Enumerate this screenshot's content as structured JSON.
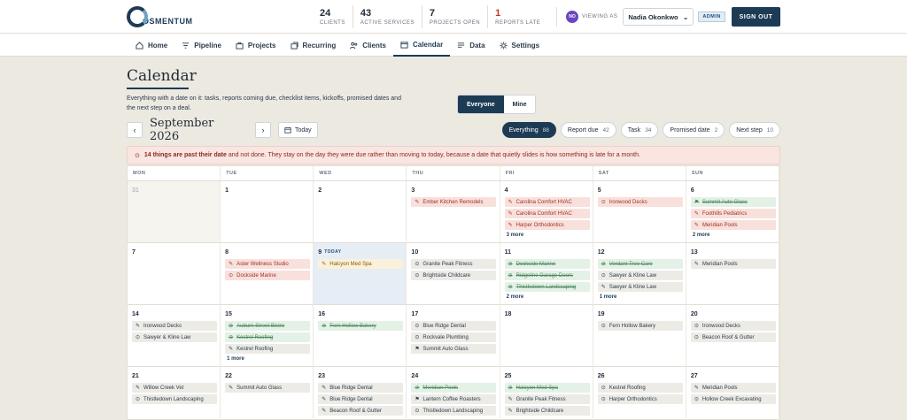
{
  "brand": {
    "name": "OSMENTUM"
  },
  "stats": [
    {
      "num": "24",
      "label": "CLIENTS",
      "alert": false
    },
    {
      "num": "43",
      "label": "ACTIVE SERVICES",
      "alert": false
    },
    {
      "num": "7",
      "label": "PROJECTS OPEN",
      "alert": false
    },
    {
      "num": "1",
      "label": "REPORTS LATE",
      "alert": true
    }
  ],
  "user": {
    "initials": "NO",
    "viewing_label": "VIEWING AS",
    "name": "Nadia Okonkwo",
    "role": "ADMIN"
  },
  "signout_label": "SIGN OUT",
  "nav": [
    {
      "label": "Home",
      "icon": "home-icon"
    },
    {
      "label": "Pipeline",
      "icon": "funnel-icon"
    },
    {
      "label": "Projects",
      "icon": "briefcase-icon"
    },
    {
      "label": "Recurring",
      "icon": "stack-icon"
    },
    {
      "label": "Clients",
      "icon": "people-icon"
    },
    {
      "label": "Calendar",
      "icon": "calendar-icon",
      "active": true
    },
    {
      "label": "Data",
      "icon": "lines-icon"
    },
    {
      "label": "Settings",
      "icon": "gear-icon"
    }
  ],
  "page": {
    "title": "Calendar",
    "description": "Everything with a date on it: tasks, reports coming due, checklist items, kickoffs, promised dates and the next step on a deal."
  },
  "scope_toggle": [
    {
      "label": "Everyone",
      "active": true
    },
    {
      "label": "Mine",
      "active": false
    }
  ],
  "month": {
    "label": "September 2026",
    "today_label": "Today"
  },
  "filters": [
    {
      "label": "Everything",
      "count": "88",
      "active": true
    },
    {
      "label": "Report due",
      "count": "42",
      "active": false
    },
    {
      "label": "Task",
      "count": "34",
      "active": false
    },
    {
      "label": "Promised date",
      "count": "2",
      "active": false
    },
    {
      "label": "Next step",
      "count": "10",
      "active": false
    }
  ],
  "warning": {
    "bold": "14 things are past their date",
    "rest": "and not done. They stay on the day they were due rather than moving to today, because a date that quietly slides is how something is late for a month."
  },
  "weekdays": [
    "MON",
    "TUE",
    "WED",
    "THU",
    "FRI",
    "SAT",
    "SUN"
  ],
  "colors": {
    "primary": "#1d3b55",
    "late": "#a33020",
    "done": "#4f8a5e",
    "today": "#e6edf5"
  },
  "weeks": [
    [
      {
        "day": "31",
        "muted": true,
        "events": []
      },
      {
        "day": "1",
        "events": []
      },
      {
        "day": "2",
        "events": []
      },
      {
        "day": "3",
        "events": [
          {
            "t": "Ember Kitchen Remodels",
            "k": "red",
            "i": "task"
          }
        ]
      },
      {
        "day": "4",
        "events": [
          {
            "t": "Carolina Comfort HVAC",
            "k": "red",
            "i": "task"
          },
          {
            "t": "Carolina Comfort HVAC",
            "k": "red",
            "i": "task"
          },
          {
            "t": "Harper Orthodontics",
            "k": "red",
            "i": "task"
          }
        ],
        "more": "3 more"
      },
      {
        "day": "5",
        "events": [
          {
            "t": "Ironwood Decks",
            "k": "red",
            "i": "report"
          }
        ]
      },
      {
        "day": "6",
        "events": [
          {
            "t": "Summit Auto Glass",
            "k": "done",
            "i": "flag"
          },
          {
            "t": "Foothills Pediatrics",
            "k": "red",
            "i": "task"
          },
          {
            "t": "Meridian Pools",
            "k": "red",
            "i": "task"
          }
        ],
        "more": "2 more"
      }
    ],
    [
      {
        "day": "7",
        "events": []
      },
      {
        "day": "8",
        "events": [
          {
            "t": "Aster Wellness Studio",
            "k": "red",
            "i": "task"
          },
          {
            "t": "Dockside Marine",
            "k": "red",
            "i": "report"
          }
        ]
      },
      {
        "day": "9",
        "today": true,
        "today_label": "TODAY",
        "events": [
          {
            "t": "Halcyon Med Spa",
            "k": "yellow",
            "i": "task"
          }
        ]
      },
      {
        "day": "10",
        "events": [
          {
            "t": "Granite Peak Fitness",
            "k": "grey",
            "i": "report"
          },
          {
            "t": "Brightside Childcare",
            "k": "grey",
            "i": "report"
          }
        ]
      },
      {
        "day": "11",
        "events": [
          {
            "t": "Dockside Marine",
            "k": "done",
            "i": "check"
          },
          {
            "t": "Ridgeline Garage Doors",
            "k": "done",
            "i": "check"
          },
          {
            "t": "Thistledown Landscaping",
            "k": "done",
            "i": "check"
          }
        ],
        "more": "2 more"
      },
      {
        "day": "12",
        "events": [
          {
            "t": "Verdant Tree Care",
            "k": "done",
            "i": "check"
          },
          {
            "t": "Sawyer & Kline Law",
            "k": "grey",
            "i": "report"
          },
          {
            "t": "Sawyer & Kline Law",
            "k": "grey",
            "i": "task"
          }
        ],
        "more": "1 more"
      },
      {
        "day": "13",
        "events": [
          {
            "t": "Meridian Pools",
            "k": "grey",
            "i": "task"
          }
        ]
      }
    ],
    [
      {
        "day": "14",
        "events": [
          {
            "t": "Ironwood Decks",
            "k": "grey",
            "i": "task"
          },
          {
            "t": "Sawyer & Kline Law",
            "k": "grey",
            "i": "report"
          }
        ]
      },
      {
        "day": "15",
        "events": [
          {
            "t": "Auburn Street Bistro",
            "k": "done",
            "i": "check"
          },
          {
            "t": "Kestrel Roofing",
            "k": "done",
            "i": "check"
          },
          {
            "t": "Kestrel Roofing",
            "k": "grey",
            "i": "task"
          }
        ],
        "more": "1 more"
      },
      {
        "day": "16",
        "events": [
          {
            "t": "Fern Hollow Bakery",
            "k": "done",
            "i": "check"
          }
        ]
      },
      {
        "day": "17",
        "events": [
          {
            "t": "Blue Ridge Dental",
            "k": "grey",
            "i": "report"
          },
          {
            "t": "Rockvale Plumbing",
            "k": "grey",
            "i": "report"
          },
          {
            "t": "Summit Auto Glass",
            "k": "grey",
            "i": "flag"
          }
        ]
      },
      {
        "day": "18",
        "events": []
      },
      {
        "day": "19",
        "events": [
          {
            "t": "Fern Hollow Bakery",
            "k": "grey",
            "i": "report"
          }
        ]
      },
      {
        "day": "20",
        "events": [
          {
            "t": "Ironwood Decks",
            "k": "grey",
            "i": "report"
          },
          {
            "t": "Beacon Roof & Gutter",
            "k": "grey",
            "i": "report"
          }
        ]
      }
    ],
    [
      {
        "day": "21",
        "events": [
          {
            "t": "Willow Creek Vet",
            "k": "grey",
            "i": "task"
          },
          {
            "t": "Thistledown Landscaping",
            "k": "grey",
            "i": "report"
          }
        ]
      },
      {
        "day": "22",
        "events": [
          {
            "t": "Summit Auto Glass",
            "k": "grey",
            "i": "task"
          }
        ]
      },
      {
        "day": "23",
        "events": [
          {
            "t": "Blue Ridge Dental",
            "k": "grey",
            "i": "task"
          },
          {
            "t": "Blue Ridge Dental",
            "k": "grey",
            "i": "task"
          },
          {
            "t": "Beacon Roof & Gutter",
            "k": "grey",
            "i": "task"
          }
        ]
      },
      {
        "day": "24",
        "events": [
          {
            "t": "Meridian Pools",
            "k": "done",
            "i": "check"
          },
          {
            "t": "Lantern Coffee Roasters",
            "k": "grey",
            "i": "flag"
          },
          {
            "t": "Thistledown Landscaping",
            "k": "grey",
            "i": "report"
          }
        ]
      },
      {
        "day": "25",
        "events": [
          {
            "t": "Halcyon Med Spa",
            "k": "done",
            "i": "check"
          },
          {
            "t": "Granite Peak Fitness",
            "k": "grey",
            "i": "task"
          },
          {
            "t": "Brightside Childcare",
            "k": "grey",
            "i": "task"
          }
        ]
      },
      {
        "day": "26",
        "events": [
          {
            "t": "Kestrel Roofing",
            "k": "grey",
            "i": "report"
          },
          {
            "t": "Harper Orthodontics",
            "k": "grey",
            "i": "report"
          }
        ]
      },
      {
        "day": "27",
        "events": [
          {
            "t": "Meridian Pools",
            "k": "grey",
            "i": "task"
          },
          {
            "t": "Hollow Creek Excavating",
            "k": "grey",
            "i": "report"
          }
        ]
      }
    ]
  ]
}
